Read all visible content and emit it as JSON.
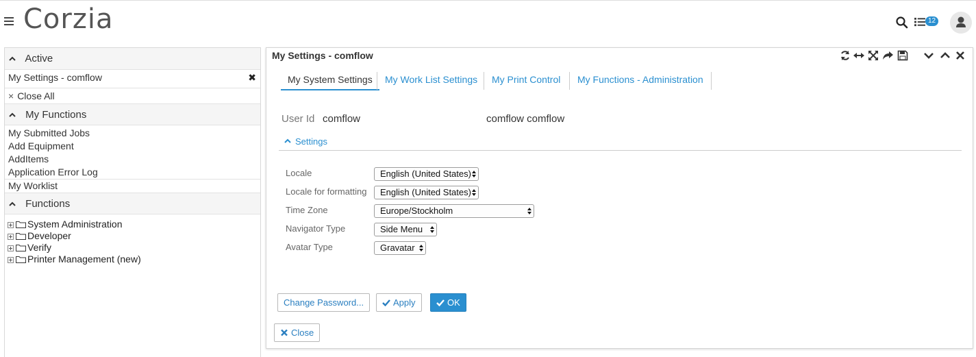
{
  "header": {
    "logo": "Corzia",
    "worklist_badge": "12"
  },
  "sidebar": {
    "active": {
      "title": "Active",
      "items": [
        {
          "label": "My Settings - comflow"
        }
      ],
      "close_all": "Close All"
    },
    "my_functions": {
      "title": "My Functions",
      "items": [
        "My Submitted Jobs",
        "Add Equipment",
        "AddItems",
        "Application Error Log"
      ],
      "worklist": "My Worklist"
    },
    "functions": {
      "title": "Functions",
      "tree": [
        "System Administration",
        "Developer",
        "Verify",
        "Printer Management (new)"
      ]
    }
  },
  "main": {
    "title": "My Settings - comflow",
    "tabs": [
      "My System Settings",
      "My Work List Settings",
      "My Print Control",
      "My Functions - Administration"
    ],
    "user_id_label": "User Id",
    "user_id": "comflow",
    "user_name": "comflow comflow",
    "settings_header": "Settings",
    "fields": [
      {
        "label": "Locale",
        "value": "English (United States)"
      },
      {
        "label": "Locale for formatting",
        "value": "English (United States)"
      },
      {
        "label": "Time Zone",
        "value": "Europe/Stockholm"
      },
      {
        "label": "Navigator Type",
        "value": "Side Menu"
      },
      {
        "label": "Avatar Type",
        "value": "Gravatar"
      }
    ],
    "buttons": {
      "change_password": "Change Password...",
      "apply": "Apply",
      "ok": "OK",
      "close": "Close"
    }
  },
  "colors": {
    "accent": "#2a8fd0"
  }
}
